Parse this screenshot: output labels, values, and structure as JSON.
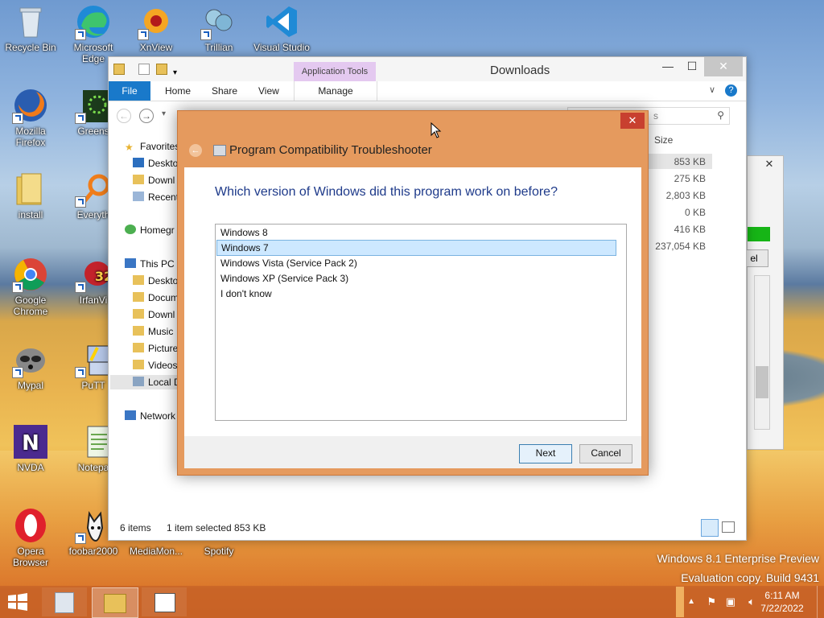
{
  "desktop": {
    "icons": [
      {
        "label": "Recycle Bin"
      },
      {
        "label": "Microsoft Edge"
      },
      {
        "label": "XnView"
      },
      {
        "label": "Trillian"
      },
      {
        "label": "Visual Studio"
      },
      {
        "label": "Mozilla Firefox"
      },
      {
        "label": "Greens"
      },
      {
        "label": "install"
      },
      {
        "label": "Everyth"
      },
      {
        "label": "Google Chrome"
      },
      {
        "label": "IrfanVi"
      },
      {
        "label": "Mypal"
      },
      {
        "label": "PuTT"
      },
      {
        "label": "NVDA"
      },
      {
        "label": "Notepa"
      },
      {
        "label": "Opera Browser"
      },
      {
        "label": "foobar2000"
      },
      {
        "label": "MediaMon..."
      },
      {
        "label": "Spotify"
      }
    ],
    "watermark": {
      "line1": "Windows 8.1 Enterprise Preview",
      "line2": "Evaluation copy. Build 9431"
    }
  },
  "explorer": {
    "title": "Downloads",
    "context_tab_header": "Application Tools",
    "tabs": [
      "File",
      "Home",
      "Share",
      "View"
    ],
    "context_tab": "Manage",
    "search_placeholder": "s",
    "column_size": "Size",
    "nav": {
      "favorites": "Favorites",
      "fav_items": [
        "Deskto",
        "Downl",
        "Recent"
      ],
      "homegroup": "Homegr",
      "thispc": "This PC",
      "pc_items": [
        "Deskto",
        "Docum",
        "Downl",
        "Music",
        "Picture",
        "Videos",
        "Local D"
      ],
      "network": "Network"
    },
    "sizes": [
      "853 KB",
      "275 KB",
      "2,803 KB",
      "0 KB",
      "416 KB",
      "237,054 KB"
    ],
    "status_items": "6 items",
    "status_selected": "1 item selected  853 KB"
  },
  "bgwin": {
    "button_label": "el"
  },
  "dialog": {
    "title": "Program Compatibility Troubleshooter",
    "question": "Which version of Windows did this program work on before?",
    "options": [
      "Windows 8",
      "Windows 7",
      "Windows Vista (Service Pack 2)",
      "Windows XP (Service Pack 3)",
      "I don't know"
    ],
    "selected_index": 1,
    "next": "Next",
    "cancel": "Cancel",
    "close": "✕"
  },
  "taskbar": {
    "time": "6:11 AM",
    "date": "7/22/2022"
  }
}
